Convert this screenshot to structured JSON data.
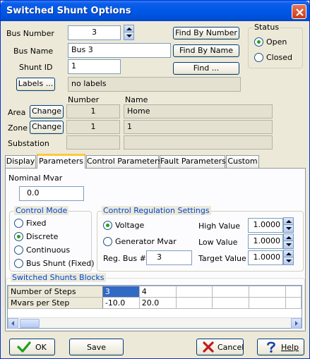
{
  "window": {
    "title": "Switched Shunt Options"
  },
  "top": {
    "bus_number_label": "Bus Number",
    "bus_number_value": "3",
    "bus_name_label": "Bus Name",
    "bus_name_value": "Bus 3",
    "shunt_id_label": "Shunt ID",
    "shunt_id_value": "1",
    "labels_button": "Labels ...",
    "labels_value": "no labels",
    "find_by_number": "Find By Number",
    "find_by_name": "Find By Name",
    "find": "Find ..."
  },
  "status": {
    "title": "Status",
    "options": [
      {
        "label": "Open",
        "selected": true
      },
      {
        "label": "Closed",
        "selected": false
      }
    ]
  },
  "assign": {
    "number_header": "Number",
    "name_header": "Name",
    "area_label": "Area",
    "area_change": "Change",
    "area_number": "1",
    "area_name": "Home",
    "zone_label": "Zone",
    "zone_change": "Change",
    "zone_number": "1",
    "zone_name": "1",
    "substation_label": "Substation",
    "substation_number": "",
    "substation_name": ""
  },
  "tabs": [
    "Display",
    "Parameters",
    "Control Parameters",
    "Fault Parameters",
    "Custom"
  ],
  "active_tab": "Parameters",
  "parameters": {
    "nominal_mvar_label": "Nominal Mvar",
    "nominal_mvar_value": "0.0",
    "control_mode": {
      "title": "Control Mode",
      "options": [
        {
          "label": "Fixed",
          "selected": false
        },
        {
          "label": "Discrete",
          "selected": true
        },
        {
          "label": "Continuous",
          "selected": false
        },
        {
          "label": "Bus Shunt (Fixed)",
          "selected": false
        }
      ]
    },
    "regulation": {
      "title": "Control Regulation Settings",
      "voltage_label": "Voltage",
      "voltage_selected": true,
      "generator_mvar_label": "Generator Mvar",
      "generator_mvar_selected": false,
      "reg_bus_label": "Reg. Bus #",
      "reg_bus_value": "3",
      "high_value_label": "High Value",
      "high_value": "1.0000",
      "low_value_label": "Low Value",
      "low_value": "1.0000",
      "target_value_label": "Target Value",
      "target_value": "1.0000"
    },
    "blocks": {
      "title": "Switched Shunts Blocks",
      "rows": [
        {
          "header": "Number of Steps",
          "cells": [
            "3",
            "4",
            "",
            "",
            "",
            "",
            ""
          ]
        },
        {
          "header": "Mvars per Step",
          "cells": [
            "-10.0",
            "20.0",
            "",
            "",
            "",
            "",
            ""
          ]
        }
      ]
    }
  },
  "footer": {
    "ok": "OK",
    "save": "Save",
    "cancel": "Cancel",
    "help": "Help"
  },
  "colors": {
    "title_bar": "#0058e6",
    "group_title": "#0046d5",
    "selected_cell": "#316ac5",
    "ok_check": "#1e9e1e",
    "cancel_x": "#c41a1a",
    "help_question": "#1a3fa8"
  }
}
